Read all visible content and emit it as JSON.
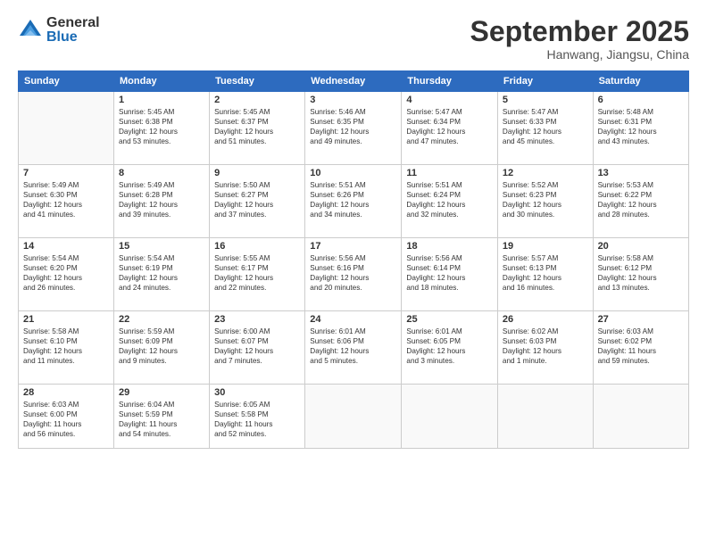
{
  "logo": {
    "general": "General",
    "blue": "Blue"
  },
  "title": "September 2025",
  "location": "Hanwang, Jiangsu, China",
  "weekdays": [
    "Sunday",
    "Monday",
    "Tuesday",
    "Wednesday",
    "Thursday",
    "Friday",
    "Saturday"
  ],
  "weeks": [
    [
      {
        "day": "",
        "info": ""
      },
      {
        "day": "1",
        "info": "Sunrise: 5:45 AM\nSunset: 6:38 PM\nDaylight: 12 hours\nand 53 minutes."
      },
      {
        "day": "2",
        "info": "Sunrise: 5:45 AM\nSunset: 6:37 PM\nDaylight: 12 hours\nand 51 minutes."
      },
      {
        "day": "3",
        "info": "Sunrise: 5:46 AM\nSunset: 6:35 PM\nDaylight: 12 hours\nand 49 minutes."
      },
      {
        "day": "4",
        "info": "Sunrise: 5:47 AM\nSunset: 6:34 PM\nDaylight: 12 hours\nand 47 minutes."
      },
      {
        "day": "5",
        "info": "Sunrise: 5:47 AM\nSunset: 6:33 PM\nDaylight: 12 hours\nand 45 minutes."
      },
      {
        "day": "6",
        "info": "Sunrise: 5:48 AM\nSunset: 6:31 PM\nDaylight: 12 hours\nand 43 minutes."
      }
    ],
    [
      {
        "day": "7",
        "info": "Sunrise: 5:49 AM\nSunset: 6:30 PM\nDaylight: 12 hours\nand 41 minutes."
      },
      {
        "day": "8",
        "info": "Sunrise: 5:49 AM\nSunset: 6:28 PM\nDaylight: 12 hours\nand 39 minutes."
      },
      {
        "day": "9",
        "info": "Sunrise: 5:50 AM\nSunset: 6:27 PM\nDaylight: 12 hours\nand 37 minutes."
      },
      {
        "day": "10",
        "info": "Sunrise: 5:51 AM\nSunset: 6:26 PM\nDaylight: 12 hours\nand 34 minutes."
      },
      {
        "day": "11",
        "info": "Sunrise: 5:51 AM\nSunset: 6:24 PM\nDaylight: 12 hours\nand 32 minutes."
      },
      {
        "day": "12",
        "info": "Sunrise: 5:52 AM\nSunset: 6:23 PM\nDaylight: 12 hours\nand 30 minutes."
      },
      {
        "day": "13",
        "info": "Sunrise: 5:53 AM\nSunset: 6:22 PM\nDaylight: 12 hours\nand 28 minutes."
      }
    ],
    [
      {
        "day": "14",
        "info": "Sunrise: 5:54 AM\nSunset: 6:20 PM\nDaylight: 12 hours\nand 26 minutes."
      },
      {
        "day": "15",
        "info": "Sunrise: 5:54 AM\nSunset: 6:19 PM\nDaylight: 12 hours\nand 24 minutes."
      },
      {
        "day": "16",
        "info": "Sunrise: 5:55 AM\nSunset: 6:17 PM\nDaylight: 12 hours\nand 22 minutes."
      },
      {
        "day": "17",
        "info": "Sunrise: 5:56 AM\nSunset: 6:16 PM\nDaylight: 12 hours\nand 20 minutes."
      },
      {
        "day": "18",
        "info": "Sunrise: 5:56 AM\nSunset: 6:14 PM\nDaylight: 12 hours\nand 18 minutes."
      },
      {
        "day": "19",
        "info": "Sunrise: 5:57 AM\nSunset: 6:13 PM\nDaylight: 12 hours\nand 16 minutes."
      },
      {
        "day": "20",
        "info": "Sunrise: 5:58 AM\nSunset: 6:12 PM\nDaylight: 12 hours\nand 13 minutes."
      }
    ],
    [
      {
        "day": "21",
        "info": "Sunrise: 5:58 AM\nSunset: 6:10 PM\nDaylight: 12 hours\nand 11 minutes."
      },
      {
        "day": "22",
        "info": "Sunrise: 5:59 AM\nSunset: 6:09 PM\nDaylight: 12 hours\nand 9 minutes."
      },
      {
        "day": "23",
        "info": "Sunrise: 6:00 AM\nSunset: 6:07 PM\nDaylight: 12 hours\nand 7 minutes."
      },
      {
        "day": "24",
        "info": "Sunrise: 6:01 AM\nSunset: 6:06 PM\nDaylight: 12 hours\nand 5 minutes."
      },
      {
        "day": "25",
        "info": "Sunrise: 6:01 AM\nSunset: 6:05 PM\nDaylight: 12 hours\nand 3 minutes."
      },
      {
        "day": "26",
        "info": "Sunrise: 6:02 AM\nSunset: 6:03 PM\nDaylight: 12 hours\nand 1 minute."
      },
      {
        "day": "27",
        "info": "Sunrise: 6:03 AM\nSunset: 6:02 PM\nDaylight: 11 hours\nand 59 minutes."
      }
    ],
    [
      {
        "day": "28",
        "info": "Sunrise: 6:03 AM\nSunset: 6:00 PM\nDaylight: 11 hours\nand 56 minutes."
      },
      {
        "day": "29",
        "info": "Sunrise: 6:04 AM\nSunset: 5:59 PM\nDaylight: 11 hours\nand 54 minutes."
      },
      {
        "day": "30",
        "info": "Sunrise: 6:05 AM\nSunset: 5:58 PM\nDaylight: 11 hours\nand 52 minutes."
      },
      {
        "day": "",
        "info": ""
      },
      {
        "day": "",
        "info": ""
      },
      {
        "day": "",
        "info": ""
      },
      {
        "day": "",
        "info": ""
      }
    ]
  ]
}
